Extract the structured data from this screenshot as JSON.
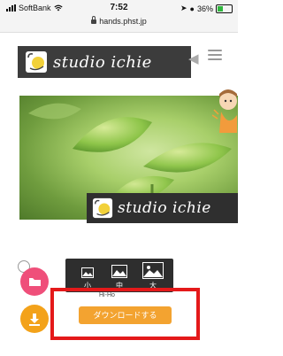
{
  "status_bar": {
    "carrier": "SoftBank",
    "time": "7:52",
    "battery": "36%",
    "url": "hands.phst.jp"
  },
  "header": {
    "logo_text": "studio ichie"
  },
  "hero": {
    "overlay_logo_text": "studio ichie"
  },
  "size_toolbar": {
    "small_label": "小",
    "medium_label": "中",
    "large_label": "大"
  },
  "caption": "Hi-Ho",
  "download": {
    "button_label": "ダウンロードする"
  },
  "colors": {
    "logo_bg": "#3c3c3c",
    "fab_folder": "#ef4f7a",
    "fab_download": "#f3a21a",
    "download_button": "#f3a330",
    "highlight": "#e4191a"
  }
}
